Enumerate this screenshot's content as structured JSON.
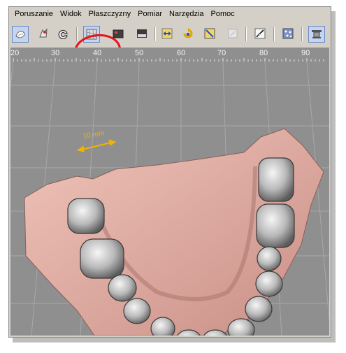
{
  "menu": {
    "items": [
      "Poruszanie",
      "Widok",
      "Płaszczyzny",
      "Pomiar",
      "Narzędzia",
      "Pomoc"
    ]
  },
  "toolbar": {
    "buttons": [
      {
        "icon": "view-model-icon",
        "pressed": true
      },
      {
        "icon": "tooth-tools-icon",
        "pressed": false
      },
      {
        "icon": "ring-icon",
        "pressed": false
      },
      {
        "icon": "grid-plane-icon",
        "pressed": true
      },
      {
        "icon": "texture-icon",
        "pressed": false
      },
      {
        "icon": "base-icon",
        "pressed": false
      },
      {
        "icon": "align-arrows-icon",
        "pressed": false
      },
      {
        "icon": "rotate-icon",
        "pressed": false
      },
      {
        "icon": "crop-icon",
        "pressed": false
      },
      {
        "icon": "disabled-tool-icon",
        "pressed": false
      },
      {
        "icon": "ruler-icon",
        "pressed": false
      },
      {
        "icon": "points-icon",
        "pressed": false
      },
      {
        "icon": "settings-icon",
        "pressed": true
      }
    ]
  },
  "ruler": {
    "labels": [
      "20",
      "30",
      "40",
      "50",
      "60",
      "70",
      "80",
      "90"
    ]
  },
  "viewport": {
    "scale_label": "10 mm",
    "colors": {
      "background": "#8f8f8f",
      "gingiva": "#e7b2a8",
      "teeth": "#b5b5b5",
      "scale": "#f2b400",
      "highlight": "#e2141c"
    }
  }
}
